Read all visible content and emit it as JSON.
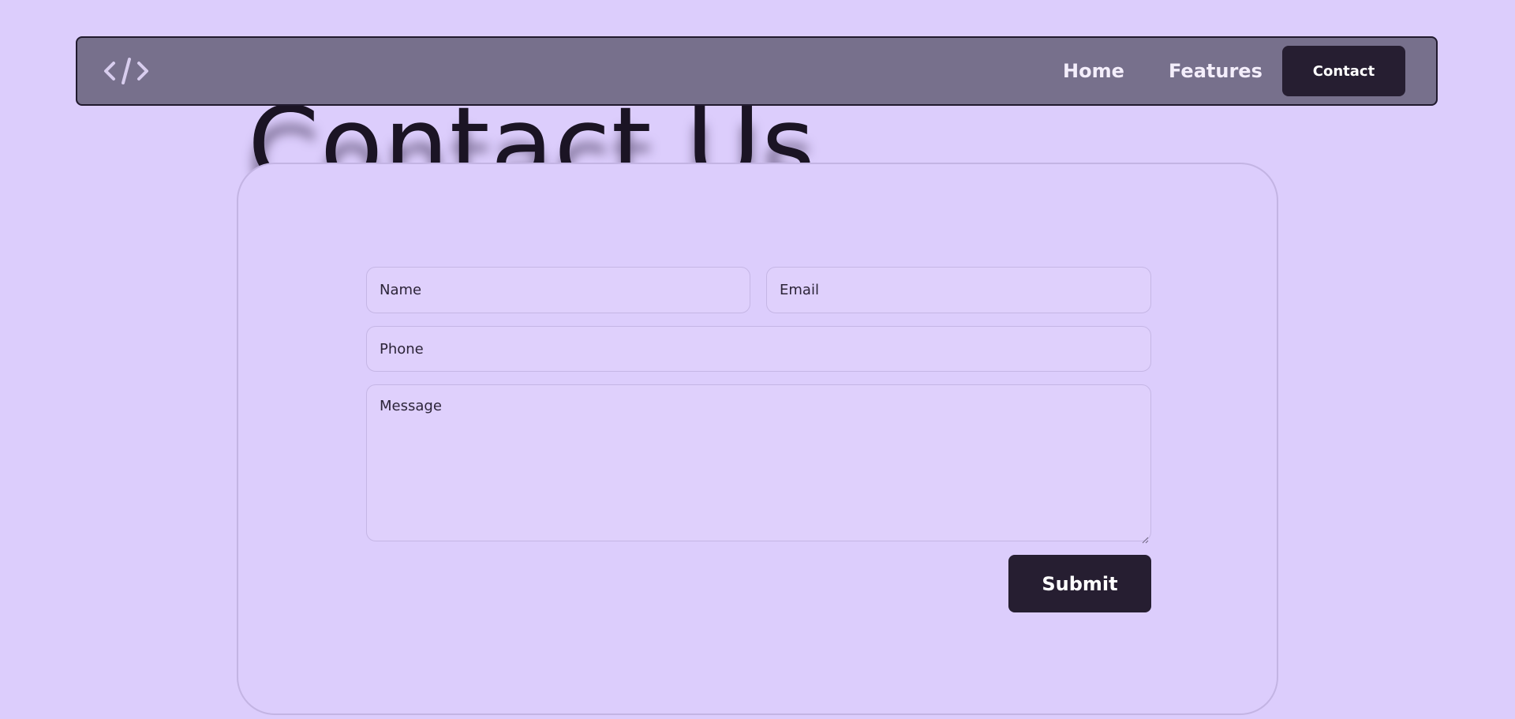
{
  "navbar": {
    "logo_icon": "code-brackets-icon",
    "links": [
      {
        "label": "Home"
      },
      {
        "label": "Features"
      }
    ],
    "contact_label": "Contact"
  },
  "main": {
    "heading": "Contact Us",
    "form": {
      "name_placeholder": "Name",
      "email_placeholder": "Email",
      "phone_placeholder": "Phone",
      "message_placeholder": "Message",
      "submit_label": "Submit"
    }
  },
  "colors": {
    "background": "#dccdfc",
    "navbar": "#77708c",
    "button": "#261e31",
    "text_dark": "#1b1424"
  }
}
